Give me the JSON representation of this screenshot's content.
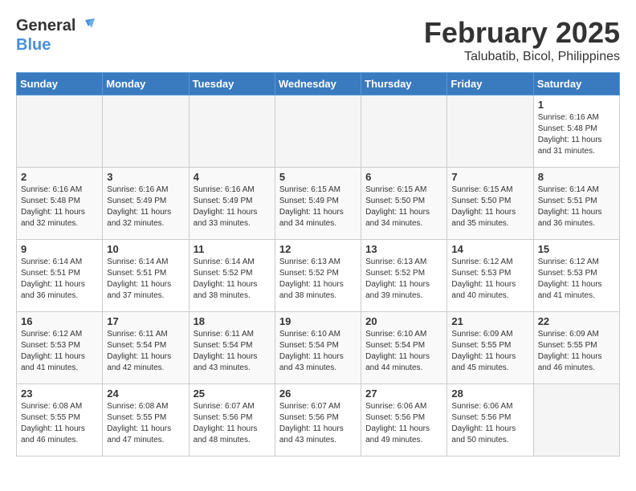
{
  "logo": {
    "line1": "General",
    "line2": "Blue"
  },
  "title": {
    "month_year": "February 2025",
    "location": "Talubatib, Bicol, Philippines"
  },
  "weekdays": [
    "Sunday",
    "Monday",
    "Tuesday",
    "Wednesday",
    "Thursday",
    "Friday",
    "Saturday"
  ],
  "weeks": [
    [
      {
        "day": "",
        "info": ""
      },
      {
        "day": "",
        "info": ""
      },
      {
        "day": "",
        "info": ""
      },
      {
        "day": "",
        "info": ""
      },
      {
        "day": "",
        "info": ""
      },
      {
        "day": "",
        "info": ""
      },
      {
        "day": "1",
        "info": "Sunrise: 6:16 AM\nSunset: 5:48 PM\nDaylight: 11 hours\nand 31 minutes."
      }
    ],
    [
      {
        "day": "2",
        "info": "Sunrise: 6:16 AM\nSunset: 5:48 PM\nDaylight: 11 hours\nand 32 minutes."
      },
      {
        "day": "3",
        "info": "Sunrise: 6:16 AM\nSunset: 5:49 PM\nDaylight: 11 hours\nand 32 minutes."
      },
      {
        "day": "4",
        "info": "Sunrise: 6:16 AM\nSunset: 5:49 PM\nDaylight: 11 hours\nand 33 minutes."
      },
      {
        "day": "5",
        "info": "Sunrise: 6:15 AM\nSunset: 5:49 PM\nDaylight: 11 hours\nand 34 minutes."
      },
      {
        "day": "6",
        "info": "Sunrise: 6:15 AM\nSunset: 5:50 PM\nDaylight: 11 hours\nand 34 minutes."
      },
      {
        "day": "7",
        "info": "Sunrise: 6:15 AM\nSunset: 5:50 PM\nDaylight: 11 hours\nand 35 minutes."
      },
      {
        "day": "8",
        "info": "Sunrise: 6:14 AM\nSunset: 5:51 PM\nDaylight: 11 hours\nand 36 minutes."
      }
    ],
    [
      {
        "day": "9",
        "info": "Sunrise: 6:14 AM\nSunset: 5:51 PM\nDaylight: 11 hours\nand 36 minutes."
      },
      {
        "day": "10",
        "info": "Sunrise: 6:14 AM\nSunset: 5:51 PM\nDaylight: 11 hours\nand 37 minutes."
      },
      {
        "day": "11",
        "info": "Sunrise: 6:14 AM\nSunset: 5:52 PM\nDaylight: 11 hours\nand 38 minutes."
      },
      {
        "day": "12",
        "info": "Sunrise: 6:13 AM\nSunset: 5:52 PM\nDaylight: 11 hours\nand 38 minutes."
      },
      {
        "day": "13",
        "info": "Sunrise: 6:13 AM\nSunset: 5:52 PM\nDaylight: 11 hours\nand 39 minutes."
      },
      {
        "day": "14",
        "info": "Sunrise: 6:12 AM\nSunset: 5:53 PM\nDaylight: 11 hours\nand 40 minutes."
      },
      {
        "day": "15",
        "info": "Sunrise: 6:12 AM\nSunset: 5:53 PM\nDaylight: 11 hours\nand 41 minutes."
      }
    ],
    [
      {
        "day": "16",
        "info": "Sunrise: 6:12 AM\nSunset: 5:53 PM\nDaylight: 11 hours\nand 41 minutes."
      },
      {
        "day": "17",
        "info": "Sunrise: 6:11 AM\nSunset: 5:54 PM\nDaylight: 11 hours\nand 42 minutes."
      },
      {
        "day": "18",
        "info": "Sunrise: 6:11 AM\nSunset: 5:54 PM\nDaylight: 11 hours\nand 43 minutes."
      },
      {
        "day": "19",
        "info": "Sunrise: 6:10 AM\nSunset: 5:54 PM\nDaylight: 11 hours\nand 43 minutes."
      },
      {
        "day": "20",
        "info": "Sunrise: 6:10 AM\nSunset: 5:54 PM\nDaylight: 11 hours\nand 44 minutes."
      },
      {
        "day": "21",
        "info": "Sunrise: 6:09 AM\nSunset: 5:55 PM\nDaylight: 11 hours\nand 45 minutes."
      },
      {
        "day": "22",
        "info": "Sunrise: 6:09 AM\nSunset: 5:55 PM\nDaylight: 11 hours\nand 46 minutes."
      }
    ],
    [
      {
        "day": "23",
        "info": "Sunrise: 6:08 AM\nSunset: 5:55 PM\nDaylight: 11 hours\nand 46 minutes."
      },
      {
        "day": "24",
        "info": "Sunrise: 6:08 AM\nSunset: 5:55 PM\nDaylight: 11 hours\nand 47 minutes."
      },
      {
        "day": "25",
        "info": "Sunrise: 6:07 AM\nSunset: 5:56 PM\nDaylight: 11 hours\nand 48 minutes."
      },
      {
        "day": "26",
        "info": "Sunrise: 6:07 AM\nSunset: 5:56 PM\nDaylight: 11 hours\nand 43 minutes."
      },
      {
        "day": "27",
        "info": "Sunrise: 6:06 AM\nSunset: 5:56 PM\nDaylight: 11 hours\nand 49 minutes."
      },
      {
        "day": "28",
        "info": "Sunrise: 6:06 AM\nSunset: 5:56 PM\nDaylight: 11 hours\nand 50 minutes."
      },
      {
        "day": "",
        "info": ""
      }
    ]
  ]
}
